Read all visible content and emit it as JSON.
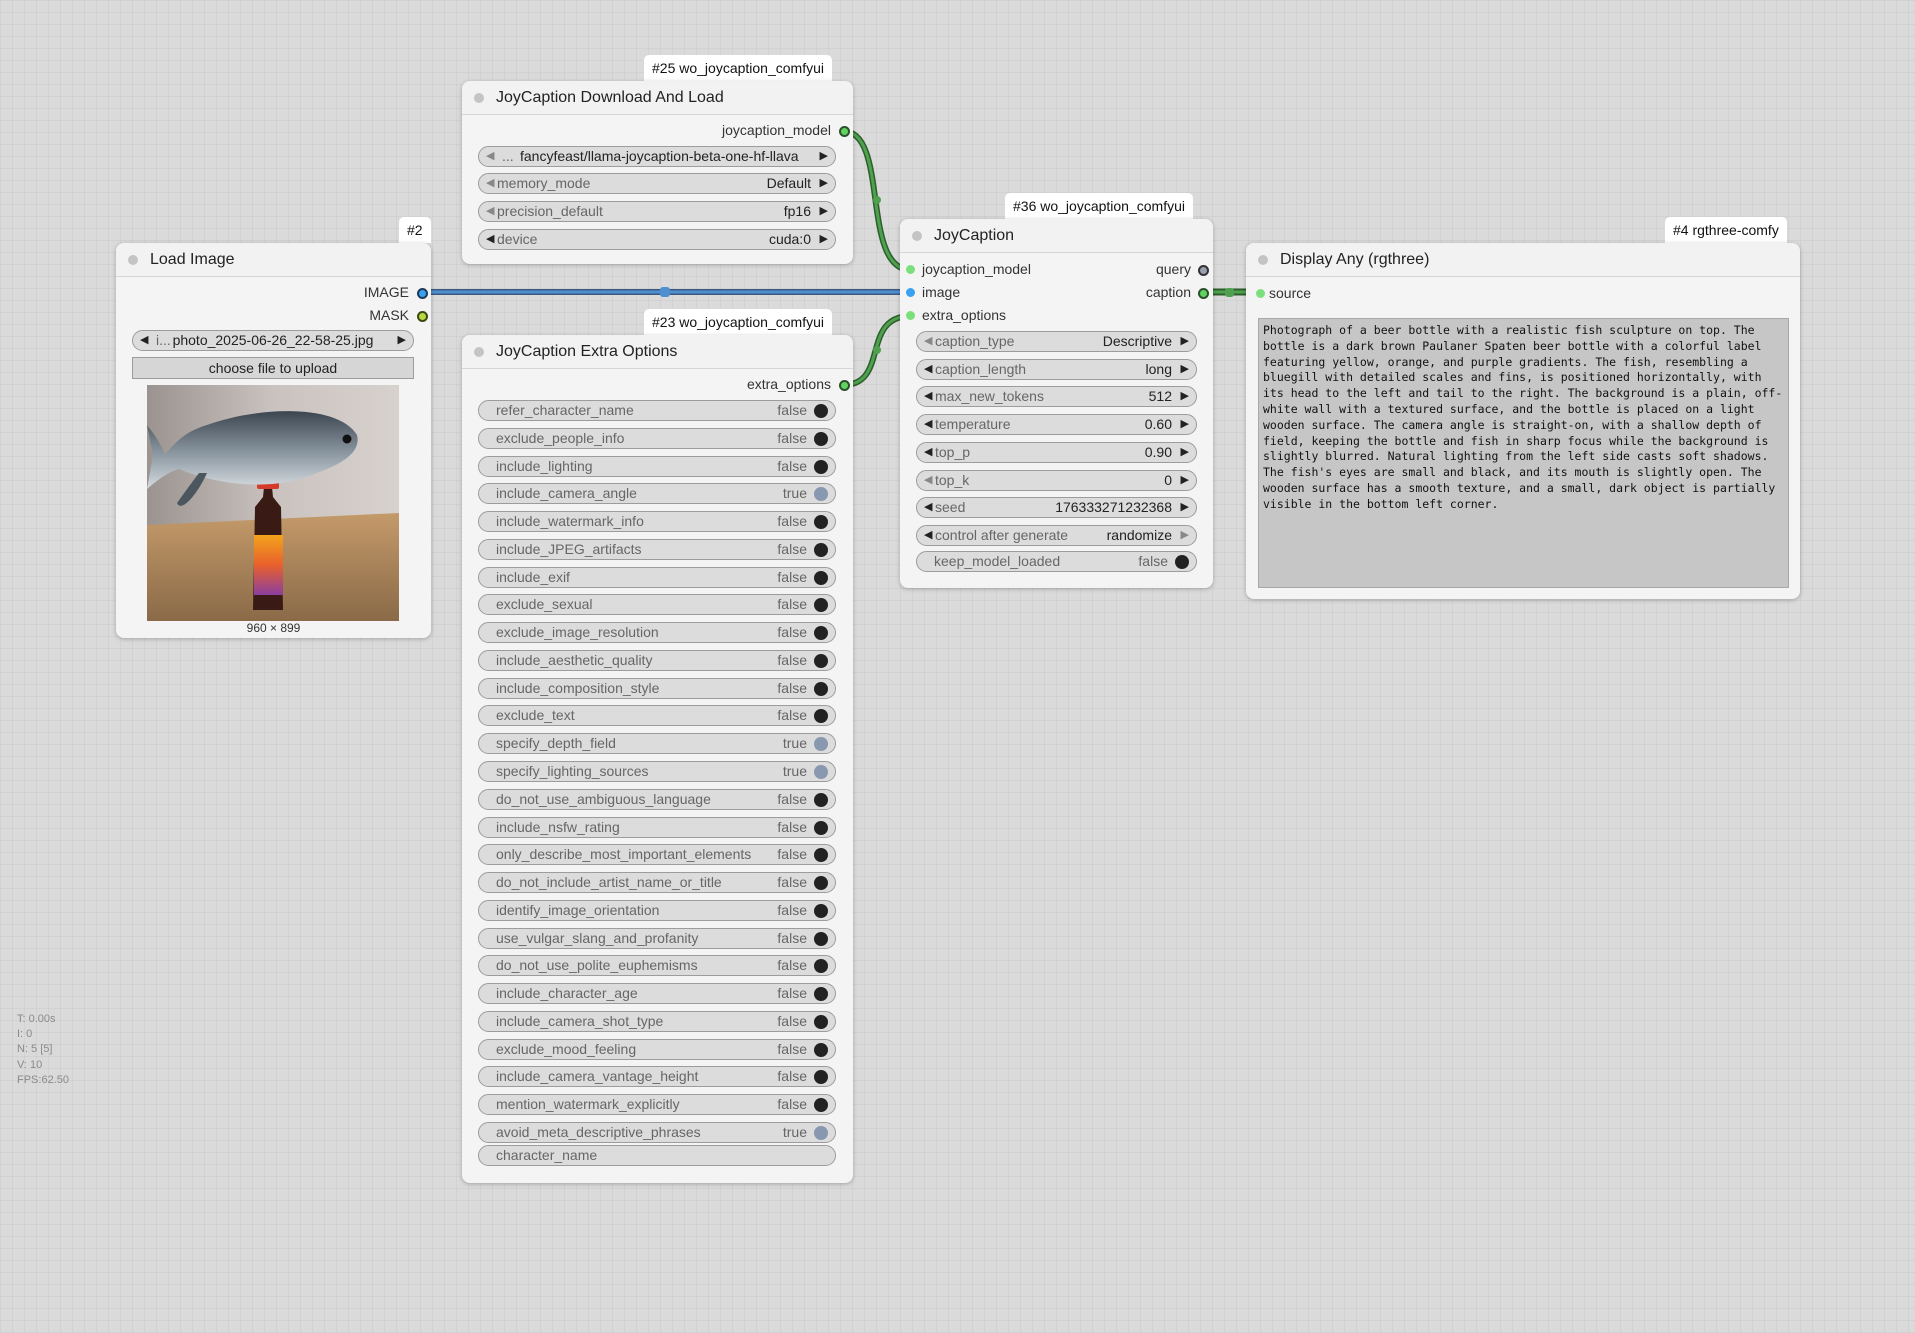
{
  "stats": {
    "time": "T: 0.00s",
    "i": "I: 0",
    "n": "N: 5 [5]",
    "v": "V: 10",
    "fps": "FPS:62.50"
  },
  "nodes": {
    "load_image": {
      "badge": "#2",
      "title": "Load Image",
      "outputs": [
        "IMAGE",
        "MASK"
      ],
      "image_prefix": "i...",
      "image_file": "photo_2025-06-26_22-58-25.jpg",
      "upload_label": "choose file to upload",
      "dimensions": "960 × 899"
    },
    "download": {
      "badge": "#25 wo_joycaption_comfyui",
      "title": "JoyCaption Download And Load",
      "output": "joycaption_model",
      "model_prefix": "...",
      "model": "fancyfeast/llama-joycaption-beta-one-hf-llava",
      "widgets": [
        {
          "label": "memory_mode",
          "value": "Default"
        },
        {
          "label": "precision_default",
          "value": "fp16"
        },
        {
          "label": "device",
          "value": "cuda:0"
        }
      ]
    },
    "extra": {
      "badge": "#23 wo_joycaption_comfyui",
      "title": "JoyCaption Extra Options",
      "output": "extra_options",
      "toggles": [
        {
          "label": "refer_character_name",
          "value": "false"
        },
        {
          "label": "exclude_people_info",
          "value": "false"
        },
        {
          "label": "include_lighting",
          "value": "false"
        },
        {
          "label": "include_camera_angle",
          "value": "true"
        },
        {
          "label": "include_watermark_info",
          "value": "false"
        },
        {
          "label": "include_JPEG_artifacts",
          "value": "false"
        },
        {
          "label": "include_exif",
          "value": "false"
        },
        {
          "label": "exclude_sexual",
          "value": "false"
        },
        {
          "label": "exclude_image_resolution",
          "value": "false"
        },
        {
          "label": "include_aesthetic_quality",
          "value": "false"
        },
        {
          "label": "include_composition_style",
          "value": "false"
        },
        {
          "label": "exclude_text",
          "value": "false"
        },
        {
          "label": "specify_depth_field",
          "value": "true"
        },
        {
          "label": "specify_lighting_sources",
          "value": "true"
        },
        {
          "label": "do_not_use_ambiguous_language",
          "value": "false"
        },
        {
          "label": "include_nsfw_rating",
          "value": "false"
        },
        {
          "label": "only_describe_most_important_elements",
          "value": "false"
        },
        {
          "label": "do_not_include_artist_name_or_title",
          "value": "false"
        },
        {
          "label": "identify_image_orientation",
          "value": "false"
        },
        {
          "label": "use_vulgar_slang_and_profanity",
          "value": "false"
        },
        {
          "label": "do_not_use_polite_euphemisms",
          "value": "false"
        },
        {
          "label": "include_character_age",
          "value": "false"
        },
        {
          "label": "include_camera_shot_type",
          "value": "false"
        },
        {
          "label": "exclude_mood_feeling",
          "value": "false"
        },
        {
          "label": "include_camera_vantage_height",
          "value": "false"
        },
        {
          "label": "mention_watermark_explicitly",
          "value": "false"
        },
        {
          "label": "avoid_meta_descriptive_phrases",
          "value": "true"
        }
      ],
      "text_widget": "character_name"
    },
    "joycaption": {
      "badge": "#36 wo_joycaption_comfyui",
      "title": "JoyCaption",
      "inputs": [
        "joycaption_model",
        "image",
        "extra_options"
      ],
      "outputs": [
        "query",
        "caption"
      ],
      "widgets": [
        {
          "label": "caption_type",
          "value": "Descriptive"
        },
        {
          "label": "caption_length",
          "value": "long"
        },
        {
          "label": "max_new_tokens",
          "value": "512"
        },
        {
          "label": "temperature",
          "value": "0.60"
        },
        {
          "label": "top_p",
          "value": "0.90"
        },
        {
          "label": "top_k",
          "value": "0"
        },
        {
          "label": "seed",
          "value": "176333271232368"
        },
        {
          "label": "control after generate",
          "value": "randomize"
        }
      ],
      "toggle": {
        "label": "keep_model_loaded",
        "value": "false"
      }
    },
    "display": {
      "badge": "#4 rgthree-comfy",
      "title": "Display Any (rgthree)",
      "input": "source",
      "text": "Photograph of a beer bottle with a realistic fish sculpture on top. The bottle is a dark brown Paulaner Spaten beer bottle with a colorful label featuring yellow, orange, and purple gradients. The fish, resembling a bluegill with detailed scales and fins, is positioned horizontally, with its head to the left and tail to the right. The background is a plain, off-white wall with a textured surface, and the bottle is placed on a light wooden surface. The camera angle is straight-on, with a shallow depth of field, keeping the bottle and fish in sharp focus while the background is slightly blurred. Natural lighting from the left side casts soft shadows. The fish's eyes are small and black, and its mouth is slightly open. The wooden surface has a smooth texture, and a small, dark object is partially visible in the bottom left corner."
    }
  },
  "colors": {
    "wire_model": "#3f8a3f",
    "wire_image": "#4f8fd0"
  }
}
